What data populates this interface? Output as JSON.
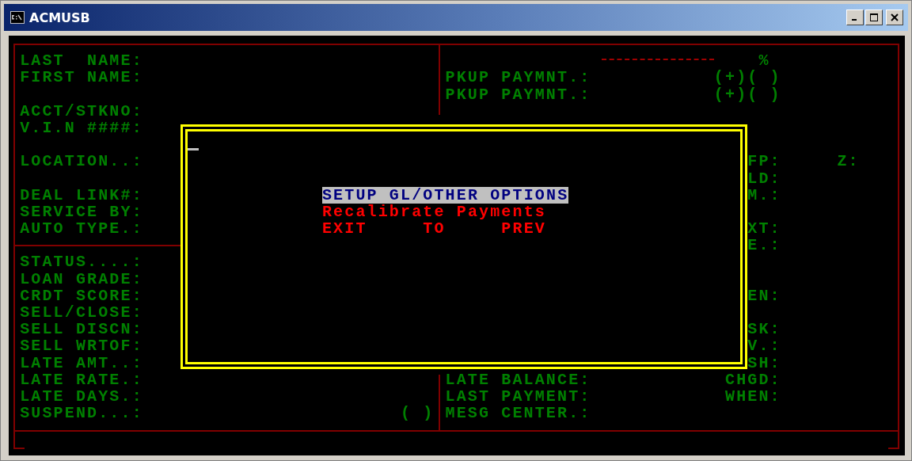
{
  "window": {
    "title": "ACMUSB"
  },
  "customer_panel": {
    "fields": [
      {
        "label": "LAST  NAME:"
      },
      {
        "label": "FIRST NAME:"
      },
      {
        "label": "ACCT/STKNO:"
      },
      {
        "label": "V.I.N ####:"
      },
      {
        "label": "LOCATION..:"
      },
      {
        "label": "DEAL LINK#:"
      },
      {
        "label": "SERVICE BY:"
      },
      {
        "label": "AUTO TYPE.:"
      }
    ]
  },
  "payment_panel": {
    "percent_sign": "%",
    "pickup_rows": [
      {
        "label": "PKUP PAYMNT.:",
        "sign_toggle": "(+)( )"
      },
      {
        "label": "PKUP PAYMNT.:",
        "sign_toggle": "(+)( )"
      }
    ]
  },
  "side_labels": [
    {
      "label": "FP:"
    },
    {
      "label": "Z:"
    },
    {
      "label": "LD:"
    },
    {
      "label": "M.:"
    },
    {
      "label": "XT:"
    },
    {
      "label": "E.:"
    },
    {
      "label": "EN:"
    },
    {
      "label": "SK:"
    },
    {
      "label": "V.:"
    },
    {
      "label": "SH:"
    },
    {
      "label": "CHGD:"
    },
    {
      "label": "WHEN:"
    }
  ],
  "status_panel": {
    "fields": [
      {
        "label": "STATUS....:"
      },
      {
        "label": "LOAN GRADE:"
      },
      {
        "label": "CRDT SCORE:"
      },
      {
        "label": "SELL/CLOSE:"
      },
      {
        "label": "SELL DISCN:"
      },
      {
        "label": "SELL WRTOF:"
      },
      {
        "label": "LATE AMT..:"
      },
      {
        "label": "LATE RATE.:"
      },
      {
        "label": "LATE DAYS.:"
      },
      {
        "label": "SUSPEND...:"
      }
    ],
    "suspend_toggle": "( )"
  },
  "balance_panel": {
    "fields": [
      {
        "label": "LATE BALANCE:"
      },
      {
        "label": "LAST PAYMENT:"
      },
      {
        "label": "MESG CENTER.:"
      }
    ]
  },
  "menu_dialog": {
    "items": [
      {
        "label": "SETUP GL/OTHER OPTIONS",
        "selected": true
      },
      {
        "label": "Recalibrate Payments",
        "selected": false
      },
      {
        "label": "EXIT     TO     PREV",
        "selected": false
      }
    ]
  }
}
